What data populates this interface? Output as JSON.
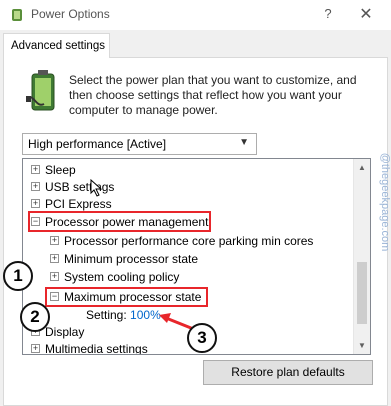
{
  "window": {
    "title": "Power Options",
    "help_glyph": "?",
    "close_glyph": "✕"
  },
  "tab": {
    "label": "Advanced settings"
  },
  "description": "Select the power plan that you want to customize, and then choose settings that reflect how you want your computer to manage power.",
  "plan_select": {
    "value": "High performance [Active]"
  },
  "tree": {
    "items": [
      {
        "label": "Sleep",
        "expander": "+"
      },
      {
        "label": "USB settings",
        "expander": "+"
      },
      {
        "label": "PCI Express",
        "expander": "+"
      },
      {
        "label": "Processor power management",
        "expander": "−"
      },
      {
        "label": "Processor performance core parking min cores",
        "expander": "+"
      },
      {
        "label": "Minimum processor state",
        "expander": "+"
      },
      {
        "label": "System cooling policy",
        "expander": "+"
      },
      {
        "label": "Maximum processor state",
        "expander": "−"
      },
      {
        "label": "Setting:",
        "value": "100%"
      },
      {
        "label": "Display",
        "expander": "+"
      },
      {
        "label": "Multimedia settings",
        "expander": "+"
      }
    ]
  },
  "buttons": {
    "restore": "Restore plan defaults"
  },
  "annotations": {
    "badge_1": "1",
    "badge_2": "2",
    "badge_3": "3",
    "accent": "#e8262b"
  },
  "watermark": "@thegeekpage.com",
  "icons": [
    "power-options-icon",
    "battery-power-icon",
    "chevron-down-icon",
    "expander-plus-icon",
    "expander-minus-icon",
    "scroll-up-icon",
    "scroll-down-icon",
    "mouse-cursor-icon"
  ]
}
